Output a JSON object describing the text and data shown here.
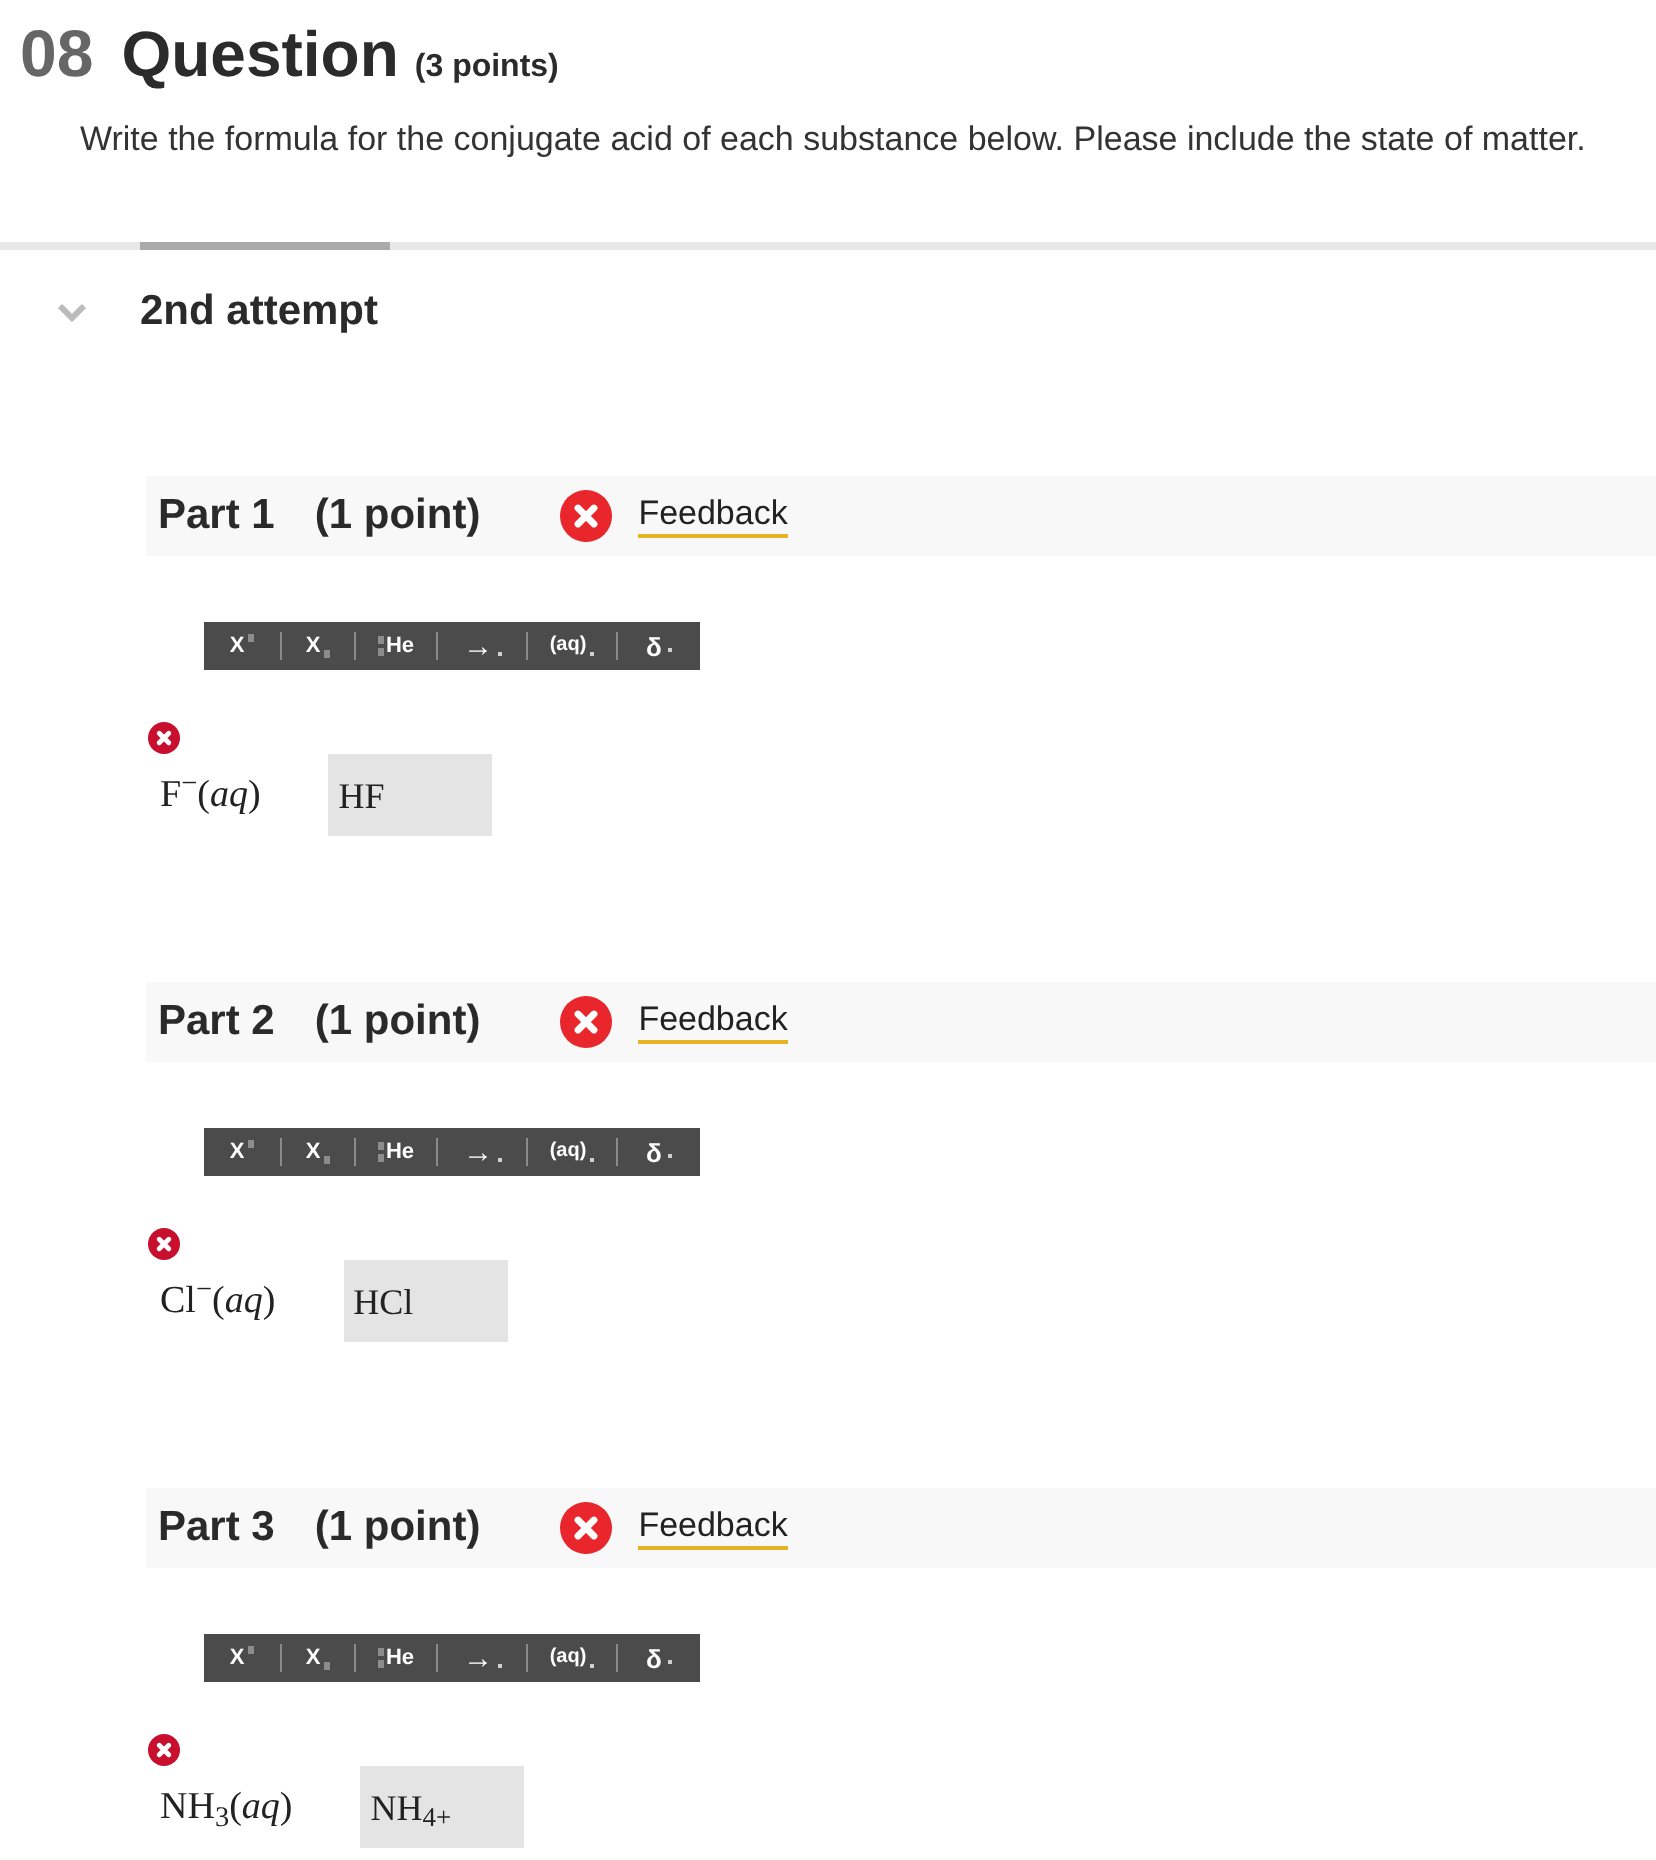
{
  "question": {
    "number": "08",
    "title": "Question",
    "points": "(3 points)",
    "prompt": "Write the formula for the conjugate acid of each substance below. Please include the state of matter."
  },
  "attempt": {
    "label": "2nd attempt",
    "expanded": true
  },
  "parts": [
    {
      "title": "Part 1",
      "points": "(1 point)",
      "correct": false,
      "feedback": "Feedback",
      "toolbar": [
        {
          "kind": "superscript",
          "label": "X"
        },
        {
          "kind": "subscript",
          "label": "X"
        },
        {
          "kind": "isotope",
          "label": "He"
        },
        {
          "kind": "arrow",
          "label": "→"
        },
        {
          "kind": "state",
          "label": "(aq)"
        },
        {
          "kind": "greek",
          "label": "δ"
        }
      ],
      "substance": "F$^{−}$(*aq*)",
      "answer": "HF"
    },
    {
      "title": "Part 2",
      "points": "(1 point)",
      "correct": false,
      "feedback": "Feedback",
      "toolbar": [
        {
          "kind": "superscript",
          "label": "X"
        },
        {
          "kind": "subscript",
          "label": "X"
        },
        {
          "kind": "isotope",
          "label": "He"
        },
        {
          "kind": "arrow",
          "label": "→"
        },
        {
          "kind": "state",
          "label": "(aq)"
        },
        {
          "kind": "greek",
          "label": "δ"
        }
      ],
      "substance": "Cl$^{−}$(*aq*)",
      "answer": "HCl"
    },
    {
      "title": "Part 3",
      "points": "(1 point)",
      "correct": false,
      "feedback": "Feedback",
      "toolbar": [
        {
          "kind": "superscript",
          "label": "X"
        },
        {
          "kind": "subscript",
          "label": "X"
        },
        {
          "kind": "isotope",
          "label": "He"
        },
        {
          "kind": "arrow",
          "label": "→"
        },
        {
          "kind": "state",
          "label": "(aq)"
        },
        {
          "kind": "greek",
          "label": "δ"
        }
      ],
      "substance": "NH$_{3}$(*aq*)",
      "answer": "NH$_{4+}$"
    }
  ]
}
